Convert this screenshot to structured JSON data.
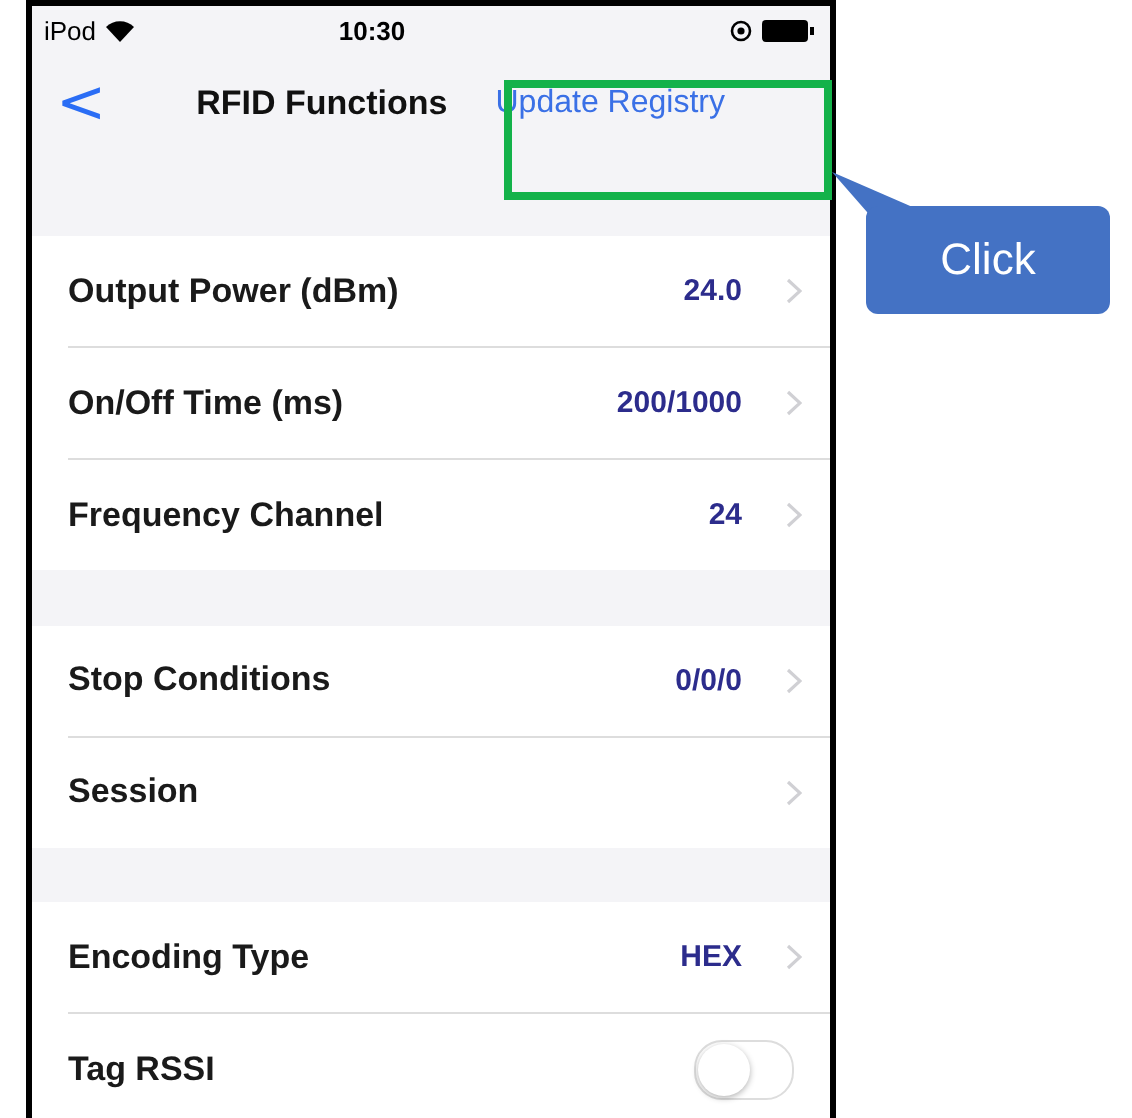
{
  "status_bar": {
    "carrier": "iPod",
    "time": "10:30"
  },
  "nav": {
    "back": "<",
    "title": "RFID Functions",
    "action": "Update Registry"
  },
  "sections": [
    {
      "rows": [
        {
          "kind": "value",
          "label": "Output Power (dBm)",
          "value": "24.0"
        },
        {
          "kind": "value",
          "label": "On/Off Time (ms)",
          "value": "200/1000"
        },
        {
          "kind": "value",
          "label": "Frequency Channel",
          "value": "24"
        }
      ]
    },
    {
      "rows": [
        {
          "kind": "value",
          "label": "Stop Conditions",
          "value": "0/0/0"
        },
        {
          "kind": "value",
          "label": "Session"
        }
      ]
    },
    {
      "rows": [
        {
          "kind": "value",
          "label": "Encoding Type",
          "value": "HEX"
        },
        {
          "kind": "toggle",
          "label": "Tag RSSI",
          "on": false
        }
      ]
    }
  ],
  "callout": {
    "text": "Click"
  }
}
